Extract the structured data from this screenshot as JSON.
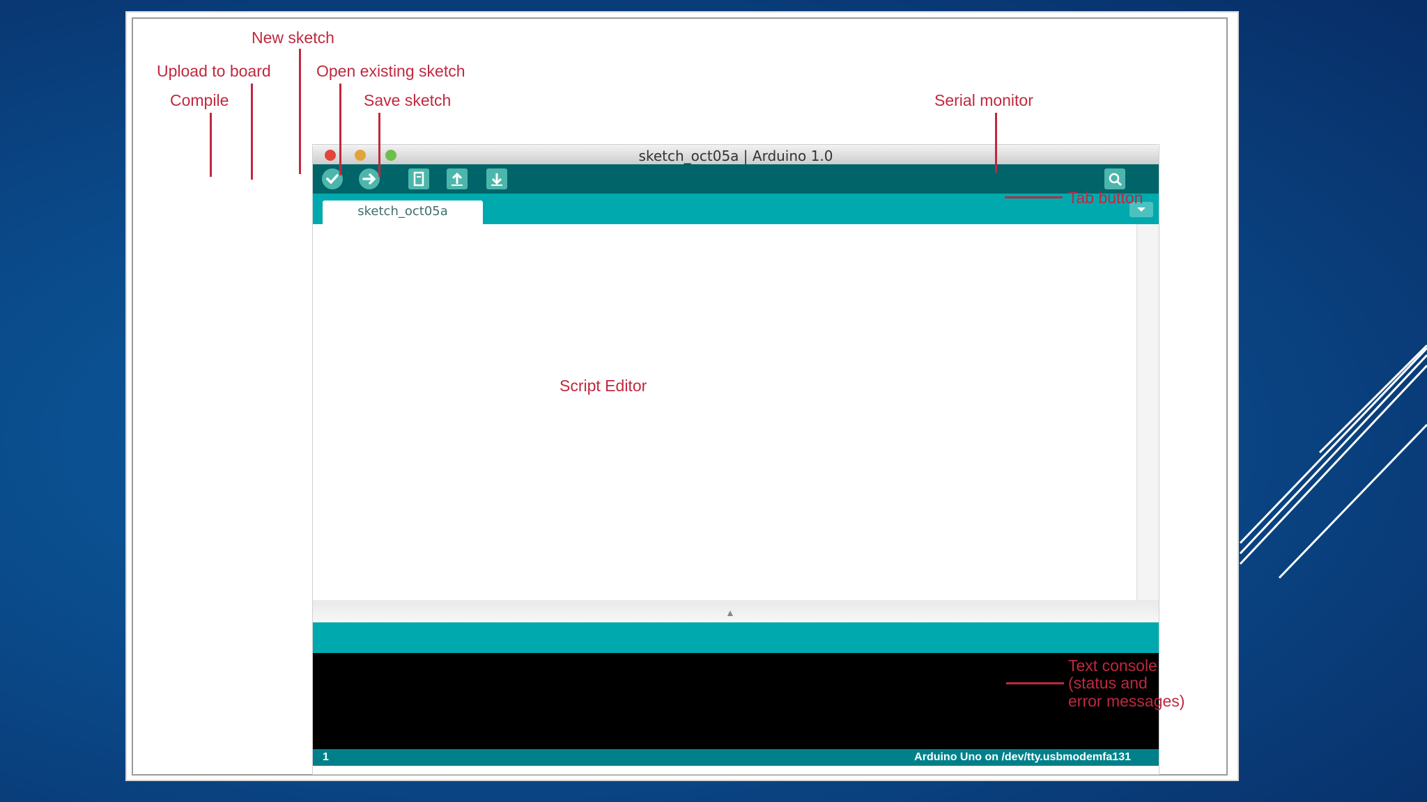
{
  "window": {
    "title": "sketch_oct05a | Arduino 1.0",
    "tab_label": "sketch_oct05a",
    "footer_line": "1",
    "footer_board": "Arduino Uno on /dev/tty.usbmodemfa131"
  },
  "annotations": {
    "new_sketch": "New sketch",
    "upload_to_board": "Upload to board",
    "open_existing_sketch": "Open existing sketch",
    "compile": "Compile",
    "save_sketch": "Save sketch",
    "serial_monitor": "Serial monitor",
    "tab_button": "Tab button",
    "script_editor": "Script Editor",
    "text_console_line1": "Text console",
    "text_console_line2": "(status and",
    "text_console_line3": "error messages)"
  },
  "icons": {
    "compile": "check-icon",
    "upload": "arrow-right-icon",
    "new": "document-icon",
    "open": "arrow-up-icon",
    "save": "arrow-down-icon",
    "serial": "magnifier-icon",
    "tab_menu": "chevron-down-icon"
  },
  "colors": {
    "toolbar": "#006468",
    "tabbar": "#00a9ad",
    "footer": "#00818a",
    "console": "#000000",
    "annotation": "#c0283e",
    "background": "#0a4a8a"
  }
}
